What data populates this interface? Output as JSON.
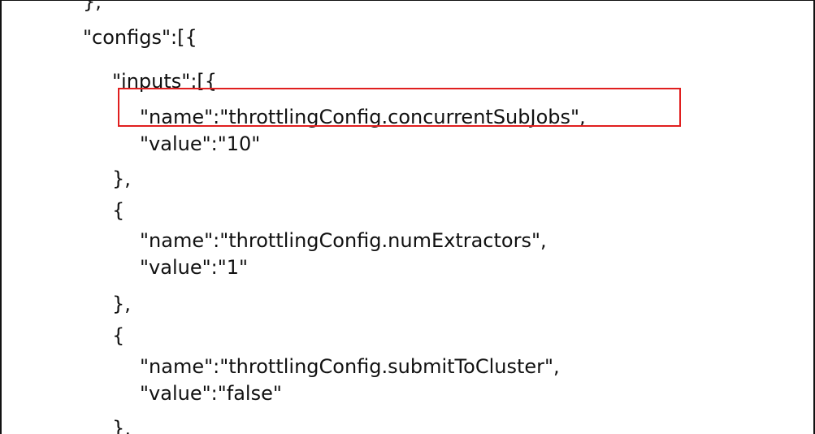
{
  "code_lines": [
    "},",
    "\"configs\":[{",
    "\"inputs\":[{",
    "\"name\":\"throttlingConfig.concurrentSubJobs\",",
    "\"value\":\"10\"",
    "},",
    "{",
    "\"name\":\"throttlingConfig.numExtractors\",",
    "\"value\":\"1\"",
    "},",
    "{",
    "\"name\":\"throttlingConfig.submitToCluster\",",
    "\"value\":\"false\"",
    "},"
  ],
  "colors": {
    "text": "#111111",
    "highlight_border": "#e01f1f",
    "background": "#ffffff"
  }
}
